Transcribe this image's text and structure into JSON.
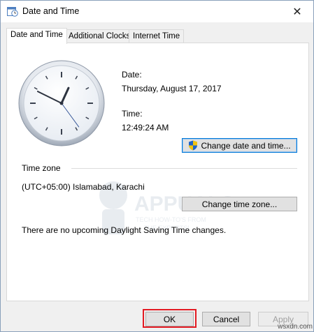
{
  "window": {
    "title": "Date and Time",
    "close_glyph": "✕"
  },
  "tabs": [
    {
      "label": "Date and Time",
      "active": true
    },
    {
      "label": "Additional Clocks",
      "active": false
    },
    {
      "label": "Internet Time",
      "active": false
    }
  ],
  "date": {
    "label": "Date:",
    "value": "Thursday, August 17, 2017"
  },
  "time": {
    "label": "Time:",
    "value": "12:49:24 AM"
  },
  "clock": {
    "hours": 12,
    "minutes": 49,
    "seconds": 24
  },
  "change_date_time_button": "Change date and time...",
  "time_zone": {
    "heading": "Time zone",
    "value": "(UTC+05:00) Islamabad, Karachi",
    "change_button": "Change time zone..."
  },
  "dst_message": "There are no upcoming Daylight Saving Time changes.",
  "buttons": {
    "ok": "OK",
    "cancel": "Cancel",
    "apply": "Apply"
  },
  "watermark": {
    "brand": "APPUALS",
    "tagline_1": "TECH HOW-TO'S FROM",
    "tagline_2": "THE EXPERTS!"
  },
  "footer_brand": "wsxdn.com",
  "colors": {
    "highlight": "#e31b23",
    "focus_border": "#0078d7",
    "shield_blue": "#1e63c9",
    "shield_yellow": "#f2c40f"
  }
}
